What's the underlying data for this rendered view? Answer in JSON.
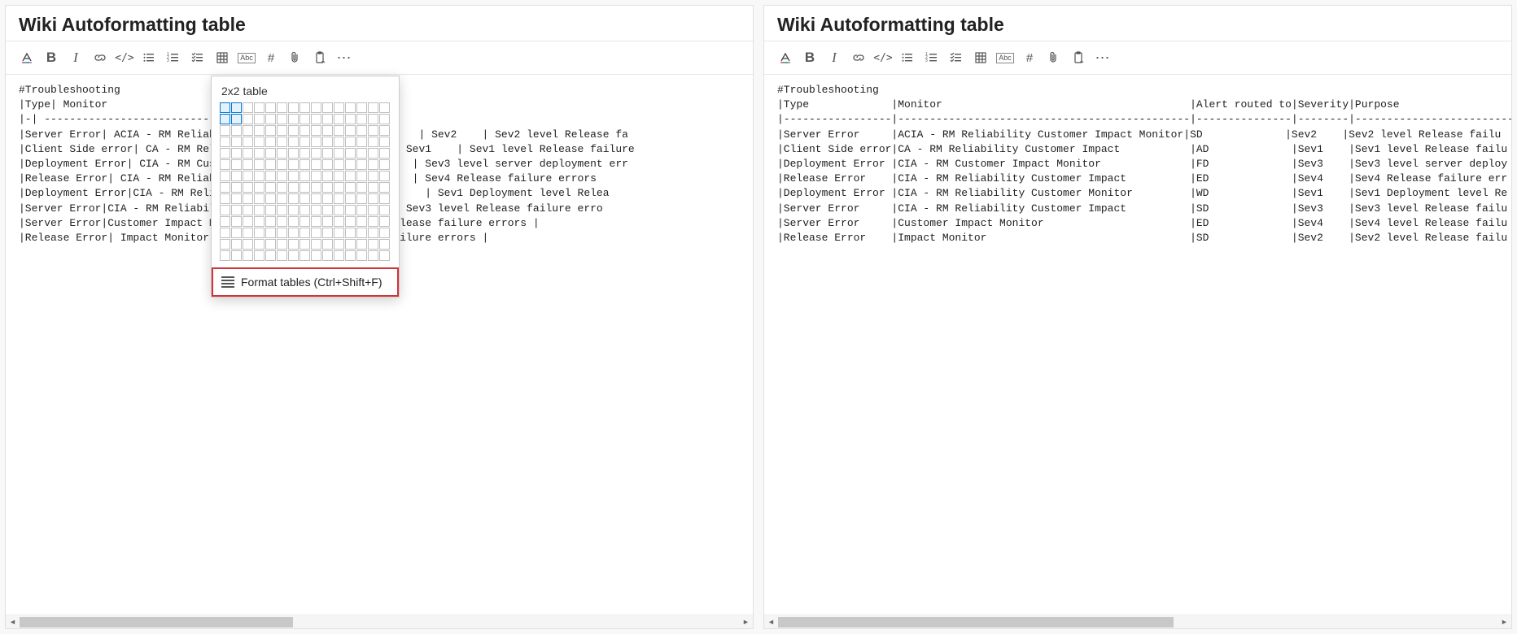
{
  "leftPane": {
    "title": "Wiki Autoformatting table",
    "toolbar": {
      "bold": "B",
      "italic": "I",
      "code": "</>",
      "abc": "Abc",
      "hash": "#",
      "more": "⋯"
    },
    "content": "#Troubleshooting\n|Type| Monitor\n|-| -----------------------------------\n|Server Error| ACIA - RM Reliability Cu                        | Sev2    | Sev2 level Release fa\n|Client Side error| CA - RM Reliability                    | Sev1    | Sev1 level Release failure\n|Deployment Error| CIA - RM Customer Im                 v3    | Sev3 level server deployment err\n|Release Error| CIA - RM Reliability Cu               Sev4    | Sev4 Release failure errors\n|Deployment Error|CIA - RM Reliability                  Sev1    | Sev1 Deployment level Relea\n|Server Error|CIA - RM Reliability Cust              v3    | Sev3 level Release failure erro\n|Server Error|Customer Impact Monitor               level Release failure errors |\n|Release Error| Impact Monitor | SD                elease failure errors |",
    "dropdown": {
      "title": "2x2 table",
      "rows": 14,
      "cols": 15,
      "selRows": 2,
      "selCols": 2,
      "formatLabel": "Format tables (Ctrl+Shift+F)"
    }
  },
  "rightPane": {
    "title": "Wiki Autoformatting table",
    "toolbar": {
      "bold": "B",
      "italic": "I",
      "code": "</>",
      "abc": "Abc",
      "hash": "#",
      "more": "⋯"
    },
    "content": "#Troubleshooting\n|Type             |Monitor                                       |Alert routed to|Severity|Purpose\n|-----------------|----------------------------------------------|---------------|--------|-------------------------\n|Server Error     |ACIA - RM Reliability Customer Impact Monitor|SD             |Sev2    |Sev2 level Release failu\n|Client Side error|CA - RM Reliability Customer Impact           |AD             |Sev1    |Sev1 level Release failu\n|Deployment Error |CIA - RM Customer Impact Monitor              |FD             |Sev3    |Sev3 level server deploy\n|Release Error    |CIA - RM Reliability Customer Impact          |ED             |Sev4    |Sev4 Release failure err\n|Deployment Error |CIA - RM Reliability Customer Monitor         |WD             |Sev1    |Sev1 Deployment level Re\n|Server Error     |CIA - RM Reliability Customer Impact          |SD             |Sev3    |Sev3 level Release failu\n|Server Error     |Customer Impact Monitor                       |ED             |Sev4    |Sev4 level Release failu\n|Release Error    |Impact Monitor                                |SD             |Sev2    |Sev2 level Release failu"
  }
}
